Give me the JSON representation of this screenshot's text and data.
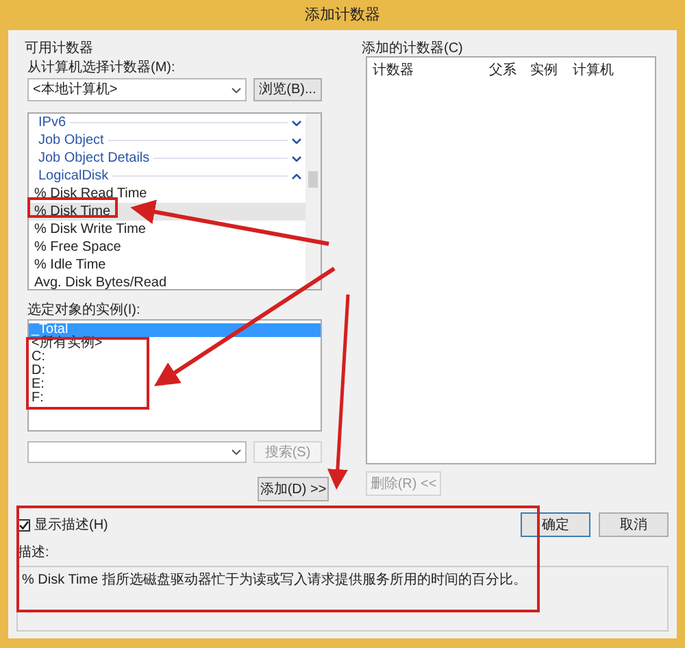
{
  "window": {
    "title": "添加计数器"
  },
  "available": {
    "label": "可用计数器",
    "computer_label": "从计算机选择计数器(M):",
    "computer": "<本地计算机>",
    "browse_button": "浏览(B)...",
    "counters": [
      {
        "kind": "category",
        "label": "IPv6",
        "expanded": false
      },
      {
        "kind": "category",
        "label": "Job Object",
        "expanded": false
      },
      {
        "kind": "category",
        "label": "Job Object Details",
        "expanded": false
      },
      {
        "kind": "category",
        "label": "LogicalDisk",
        "expanded": true
      },
      {
        "kind": "counter",
        "label": "% Disk Read Time",
        "selected": false
      },
      {
        "kind": "counter",
        "label": "% Disk Time",
        "selected": true
      },
      {
        "kind": "counter",
        "label": "% Disk Write Time",
        "selected": false
      },
      {
        "kind": "counter",
        "label": "% Free Space",
        "selected": false
      },
      {
        "kind": "counter",
        "label": "% Idle Time",
        "selected": false
      },
      {
        "kind": "counter",
        "label": "Avg. Disk Bytes/Read",
        "selected": false
      }
    ]
  },
  "instances": {
    "label": "选定对象的实例(I):",
    "items": [
      {
        "label": "_Total",
        "selected": true
      },
      {
        "label": "<所有实例>",
        "selected": false
      },
      {
        "label": "C:",
        "selected": false
      },
      {
        "label": "D:",
        "selected": false
      },
      {
        "label": "E:",
        "selected": false
      },
      {
        "label": "F:",
        "selected": false
      }
    ]
  },
  "search": {
    "button": "搜索(S)",
    "disabled": true
  },
  "add_button": "添加(D) >>",
  "added": {
    "label": "添加的计数器(C)",
    "columns": [
      "计数器",
      "父系",
      "实例",
      "计算机"
    ],
    "remove_button": "删除(R) <<",
    "remove_disabled": true
  },
  "show_description": {
    "label": "显示描述(H)",
    "checked": true
  },
  "description_label": "描述:",
  "description": "% Disk Time 指所选磁盘驱动器忙于为读或写入请求提供服务所用的时间的百分比。",
  "buttons": [
    "确定",
    "取消"
  ]
}
